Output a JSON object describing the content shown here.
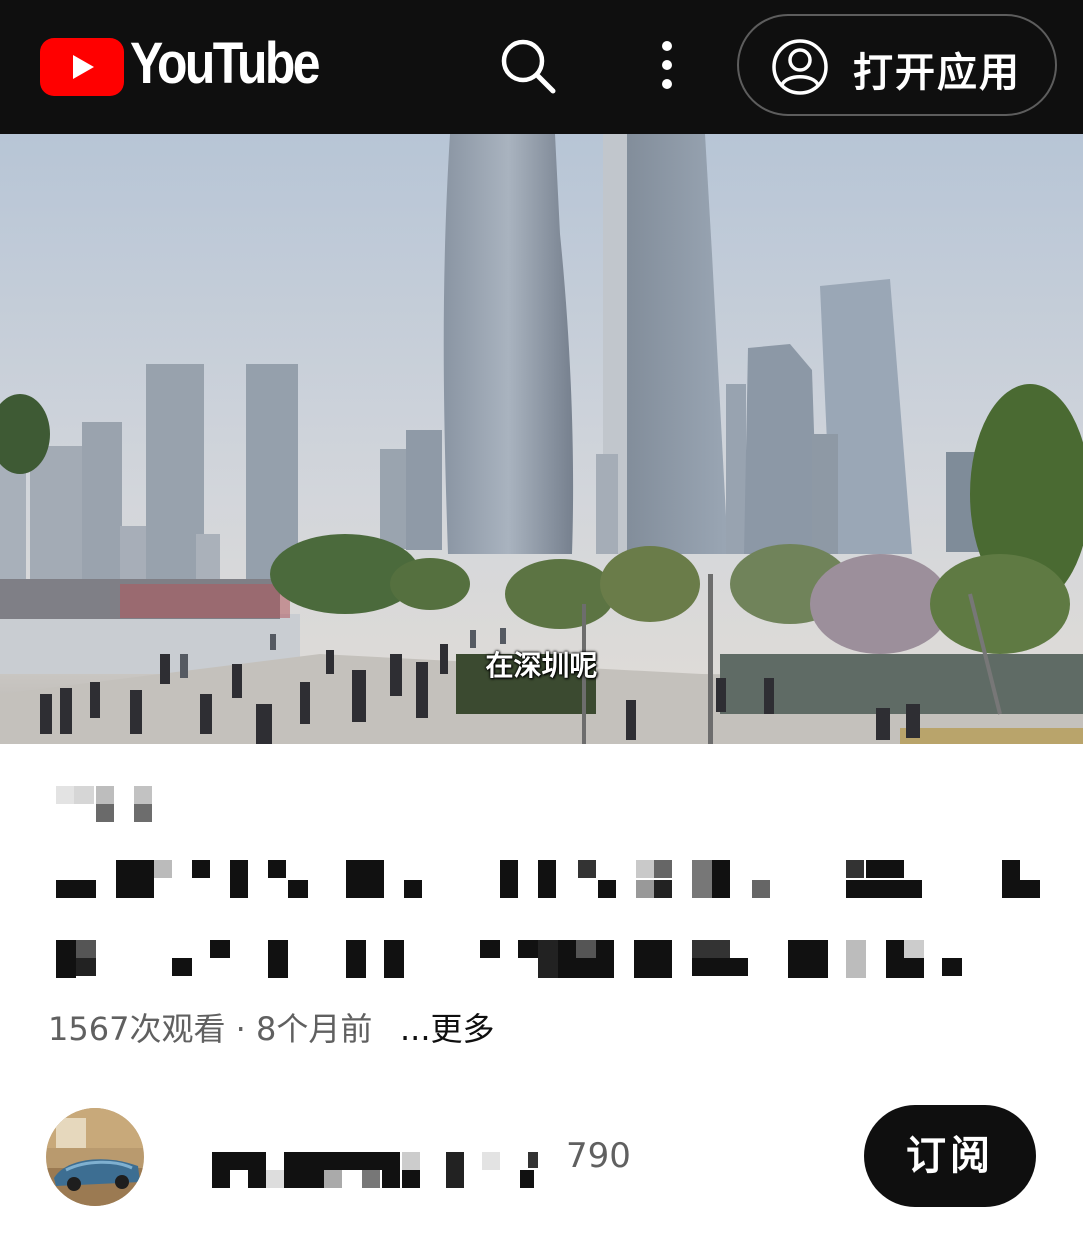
{
  "header": {
    "brand": "YouTube",
    "open_app_label": "打开应用",
    "icons": [
      "youtube-logo-icon",
      "search-icon",
      "more-vert-icon",
      "account-icon"
    ]
  },
  "video": {
    "caption": "在深圳呢"
  },
  "info": {
    "meta": "1567次观看 · 8个月前",
    "more_link": "...更多"
  },
  "channel": {
    "subscriber_count": "790",
    "subscribe_label": "订阅"
  },
  "colors": {
    "header_bg": "#0f0f0f",
    "youtube_red": "#ff0000",
    "meta_text": "#606060",
    "button_bg": "#0f0f0f"
  }
}
